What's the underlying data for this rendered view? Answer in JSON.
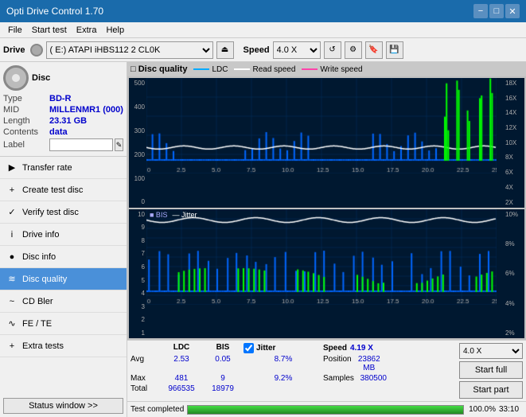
{
  "titlebar": {
    "title": "Opti Drive Control 1.70",
    "minimize": "−",
    "maximize": "□",
    "close": "✕"
  },
  "menu": {
    "items": [
      "File",
      "Start test",
      "Extra",
      "Help"
    ]
  },
  "toolbar": {
    "drive_label": "Drive",
    "drive_value": "(E:)  ATAPI iHBS112  2 CL0K",
    "speed_label": "Speed",
    "speed_value": "4.0 X"
  },
  "disc": {
    "title": "Disc",
    "type_label": "Type",
    "type_value": "BD-R",
    "mid_label": "MID",
    "mid_value": "MILLENMR1 (000)",
    "length_label": "Length",
    "length_value": "23.31 GB",
    "contents_label": "Contents",
    "contents_value": "data",
    "label_label": "Label"
  },
  "nav": {
    "items": [
      {
        "id": "transfer-rate",
        "label": "Transfer rate",
        "icon": "▶"
      },
      {
        "id": "create-test-disc",
        "label": "Create test disc",
        "icon": "+"
      },
      {
        "id": "verify-test-disc",
        "label": "Verify test disc",
        "icon": "✓"
      },
      {
        "id": "drive-info",
        "label": "Drive info",
        "icon": "i"
      },
      {
        "id": "disc-info",
        "label": "Disc info",
        "icon": "●"
      },
      {
        "id": "disc-quality",
        "label": "Disc quality",
        "icon": "≋",
        "active": true
      },
      {
        "id": "cd-bler",
        "label": "CD Bler",
        "icon": "~"
      },
      {
        "id": "fe-te",
        "label": "FE / TE",
        "icon": "∿"
      },
      {
        "id": "extra-tests",
        "label": "Extra tests",
        "icon": "+"
      }
    ]
  },
  "status_window_btn": "Status window >>",
  "chart": {
    "title": "Disc quality",
    "upper": {
      "legend": [
        {
          "label": "LDC",
          "color": "#00aaff"
        },
        {
          "label": "Read speed",
          "color": "#ffffff"
        },
        {
          "label": "Write speed",
          "color": "#ff44aa"
        }
      ],
      "y_max": 500,
      "x_max": 25,
      "right_labels": [
        "18X",
        "16X",
        "14X",
        "12X",
        "10X",
        "8X",
        "6X",
        "4X",
        "2X"
      ]
    },
    "lower": {
      "legend": [
        {
          "label": "BIS",
          "color": "#00aaff"
        },
        {
          "label": "Jitter",
          "color": "#ffffff"
        }
      ],
      "y_max": 10,
      "x_max": 25,
      "right_labels": [
        "10%",
        "8%",
        "6%",
        "4%",
        "2%"
      ]
    }
  },
  "stats": {
    "headers": [
      "",
      "LDC",
      "BIS",
      "",
      "Jitter",
      "Speed",
      ""
    ],
    "avg_label": "Avg",
    "avg_ldc": "2.53",
    "avg_bis": "0.05",
    "avg_jitter": "8.7%",
    "max_label": "Max",
    "max_ldc": "481",
    "max_bis": "9",
    "max_jitter": "9.2%",
    "total_label": "Total",
    "total_ldc": "966535",
    "total_bis": "18979",
    "jitter_checked": true,
    "jitter_label": "Jitter",
    "speed_label": "Speed",
    "speed_value": "4.19 X",
    "speed_select": "4.0 X",
    "position_label": "Position",
    "position_value": "23862 MB",
    "samples_label": "Samples",
    "samples_value": "380500"
  },
  "buttons": {
    "start_full": "Start full",
    "start_part": "Start part"
  },
  "progress": {
    "percent": "100.0%",
    "fill": 100,
    "time": "33:10"
  },
  "status": {
    "text": "Test completed"
  }
}
